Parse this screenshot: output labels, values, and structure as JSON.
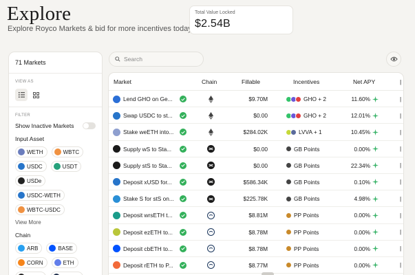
{
  "header": {
    "title": "Explore",
    "subtitle": "Explore Royco Markets & bid for more incentives today."
  },
  "tvl": {
    "label": "Total Value Locked",
    "value": "$2.54B"
  },
  "sidebar": {
    "markets_count": "71",
    "markets_label": "Markets",
    "view_as_label": "VIEW AS",
    "filter_label": "FILTER",
    "show_inactive_label": "Show Inactive Markets",
    "input_asset_title": "Input Asset",
    "input_assets": [
      {
        "label": "WETH",
        "color": "#6b7dbd"
      },
      {
        "label": "WBTC",
        "color": "#f09242"
      },
      {
        "label": "USDC",
        "color": "#2775ca"
      },
      {
        "label": "USDT",
        "color": "#26a17b"
      },
      {
        "label": "USDe",
        "color": "#222222"
      },
      {
        "label": "USDC-WETH",
        "color": "#2775ca"
      },
      {
        "label": "WBTC-USDC",
        "color": "#f09242"
      }
    ],
    "view_more_label": "View More",
    "chain_title": "Chain",
    "chains": [
      {
        "label": "ARB",
        "color": "#28a0f0"
      },
      {
        "label": "BASE",
        "color": "#0052ff"
      },
      {
        "label": "CORN",
        "color": "#f6851b"
      },
      {
        "label": "ETH",
        "color": "#627eea"
      },
      {
        "label": "HYPE",
        "color": "#222222"
      },
      {
        "label": "SONIC",
        "color": "#1d2c48"
      }
    ]
  },
  "search": {
    "placeholder": "Search"
  },
  "table": {
    "headers": {
      "market": "Market",
      "chain": "Chain",
      "fillable": "Fillable",
      "incentives": "Incentives",
      "apy": "Net APY"
    },
    "rows": [
      {
        "market": "Lend GHO on Ge...",
        "icon": "ghost-icon",
        "icon_color": "#2b6fd6",
        "chain": "ethereum-icon",
        "fillable": "$9.70M",
        "incentive": "GHO + 2",
        "apy": "11.60%",
        "inc_colors": [
          "#34c46a",
          "#6a58d8",
          "#e23f3f"
        ]
      },
      {
        "market": "Swap USDC to st...",
        "icon": "swap-icon",
        "icon_color": "#2775ca",
        "chain": "ethereum-icon",
        "fillable": "$0.00",
        "incentive": "GHO + 2",
        "apy": "12.01%",
        "inc_colors": [
          "#34c46a",
          "#6a58d8",
          "#e23f3f"
        ]
      },
      {
        "market": "Stake weETH into...",
        "icon": "stake-icon",
        "icon_color": "#8e9fcf",
        "chain": "ethereum-icon",
        "fillable": "$284.02K",
        "incentive": "LVVA + 1",
        "apy": "10.45%",
        "inc_colors": [
          "#c6d93a",
          "#5a6a9a"
        ]
      },
      {
        "market": "Supply wS to Sta...",
        "icon": "sonic-icon",
        "icon_color": "#1a1a1a",
        "chain": "sonic-icon",
        "fillable": "$0.00",
        "incentive": "GB Points",
        "apy": "0.00%",
        "inc_colors": [
          "#444444"
        ]
      },
      {
        "market": "Supply stS to Sta...",
        "icon": "sonic-icon",
        "icon_color": "#1a1a1a",
        "chain": "sonic-icon",
        "fillable": "$0.00",
        "incentive": "GB Points",
        "apy": "22.34%",
        "inc_colors": [
          "#444444"
        ]
      },
      {
        "market": "Deposit xUSD for...",
        "icon": "usd-icon",
        "icon_color": "#2775ca",
        "chain": "sonic-icon",
        "fillable": "$586.34K",
        "incentive": "GB Points",
        "apy": "0.10%",
        "inc_colors": [
          "#444444"
        ]
      },
      {
        "market": "Stake S for stS on...",
        "icon": "sonic-icon",
        "icon_color": "#2a8fd6",
        "chain": "sonic-icon",
        "fillable": "$225.78K",
        "incentive": "GB Points",
        "apy": "4.98%",
        "inc_colors": [
          "#444444"
        ]
      },
      {
        "market": "Deposit wrsETH t...",
        "icon": "drop-icon",
        "icon_color": "#1a9c8a",
        "chain": "hyperliquid-icon",
        "fillable": "$8.81M",
        "incentive": "PP Points",
        "apy": "0.00%",
        "inc_colors": [
          "#c98a2b"
        ]
      },
      {
        "market": "Deposit ezETH to...",
        "icon": "ez-icon",
        "icon_color": "#b9c63a",
        "chain": "hyperliquid-icon",
        "fillable": "$8.78M",
        "incentive": "PP Points",
        "apy": "0.00%",
        "inc_colors": [
          "#c98a2b"
        ]
      },
      {
        "market": "Deposit cbETH to...",
        "icon": "cb-icon",
        "icon_color": "#0052ff",
        "chain": "hyperliquid-icon",
        "fillable": "$8.78M",
        "incentive": "PP Points",
        "apy": "0.00%",
        "inc_colors": [
          "#c98a2b"
        ]
      },
      {
        "market": "Deposit rETH to P...",
        "icon": "reth-icon",
        "icon_color": "#f26a3a",
        "chain": "hyperliquid-icon",
        "fillable": "$8.77M",
        "incentive": "PP Points",
        "apy": "0.00%",
        "inc_colors": [
          "#c98a2b"
        ]
      }
    ]
  }
}
